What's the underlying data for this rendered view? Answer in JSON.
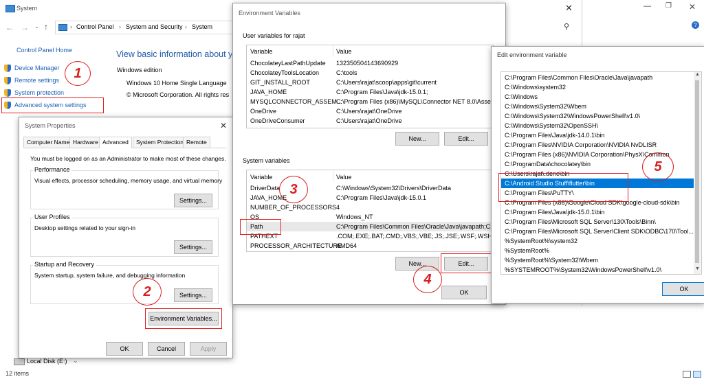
{
  "system_window": {
    "title": "System",
    "breadcrumb": [
      "Control Panel",
      "System and Security",
      "System"
    ],
    "left_links": {
      "home": "Control Panel Home",
      "items": [
        "Device Manager",
        "Remote settings",
        "System protection",
        "Advanced system settings"
      ]
    },
    "heading": "View basic information about yo",
    "edition_label": "Windows edition",
    "edition": "Windows 10 Home Single Language",
    "copyright": "© Microsoft Corporation. All rights res",
    "local_disk": "Local Disk (E:)",
    "items_count": "12 items"
  },
  "system_properties": {
    "title": "System Properties",
    "tabs": [
      "Computer Name",
      "Hardware",
      "Advanced",
      "System Protection",
      "Remote"
    ],
    "admin_note": "You must be logged on as an Administrator to make most of these changes.",
    "performance": {
      "label": "Performance",
      "desc": "Visual effects, processor scheduling, memory usage, and virtual memory",
      "button": "Settings..."
    },
    "user_profiles": {
      "label": "User Profiles",
      "desc": "Desktop settings related to your sign-in",
      "button": "Settings..."
    },
    "startup": {
      "label": "Startup and Recovery",
      "desc": "System startup, system failure, and debugging information",
      "button": "Settings..."
    },
    "env_button": "Environment Variables...",
    "ok": "OK",
    "cancel": "Cancel",
    "apply": "Apply"
  },
  "env_vars": {
    "title": "Environment Variables",
    "user_section": "User variables for rajat",
    "columns": [
      "Variable",
      "Value"
    ],
    "user_rows": [
      [
        "ChocolateyLastPathUpdate",
        "132350504143690929"
      ],
      [
        "ChocolateyToolsLocation",
        "C:\\tools"
      ],
      [
        "GIT_INSTALL_ROOT",
        "C:\\Users\\rajat\\scoop\\apps\\git\\current"
      ],
      [
        "JAVA_HOME",
        "C:\\Program Files\\Java\\jdk-15.0.1;"
      ],
      [
        "MYSQLCONNECTOR_ASSEM...",
        "C:\\Program Files (x86)\\MySQL\\Connector NET 8.0\\Assem"
      ],
      [
        "OneDrive",
        "C:\\Users\\rajat\\OneDrive"
      ],
      [
        "OneDriveConsumer",
        "C:\\Users\\rajat\\OneDrive"
      ]
    ],
    "user_new": "New...",
    "user_edit": "Edit...",
    "system_section": "System variables",
    "system_rows": [
      [
        "DriverData",
        "C:\\Windows\\System32\\Drivers\\DriverData"
      ],
      [
        "JAVA_HOME",
        "C:\\Program Files\\Java\\jdk-15.0.1"
      ],
      [
        "NUMBER_OF_PROCESSORS",
        "4"
      ],
      [
        "OS",
        "Windows_NT"
      ],
      [
        "Path",
        "C:\\Program Files\\Common Files\\Oracle\\Java\\javapath;C:"
      ],
      [
        "PATHEXT",
        ".COM;.EXE;.BAT;.CMD;.VBS;.VBE;.JS;.JSE;.WSF;.WSH;.MSC"
      ],
      [
        "PROCESSOR_ARCHITECTURE",
        "AMD64"
      ]
    ],
    "sys_new": "New...",
    "sys_edit": "Edit...",
    "ok": "OK"
  },
  "edit_env": {
    "title": "Edit environment variable",
    "entries": [
      "C:\\Program Files\\Common Files\\Oracle\\Java\\javapath",
      "C:\\Windows\\system32",
      "C:\\Windows",
      "C:\\Windows\\System32\\Wbem",
      "C:\\Windows\\System32\\WindowsPowerShell\\v1.0\\",
      "C:\\Windows\\System32\\OpenSSH\\",
      "C:\\Program Files\\Java\\jdk-14.0.1\\bin",
      "C:\\Program Files\\NVIDIA Corporation\\NVIDIA NvDLISR",
      "C:\\Program Files (x86)\\NVIDIA Corporation\\PhysX\\Common",
      "C:\\ProgramData\\chocolatey\\bin",
      "C:\\Users\\rajat\\.deno\\bin",
      "C:\\Android Studio Stuff\\flutter\\bin",
      "C:\\Program Files\\PuTTY\\",
      "C:\\Program Files (x86)\\Google\\Cloud SDK\\google-cloud-sdk\\bin",
      "C:\\Program Files\\Java\\jdk-15.0.1\\bin",
      "C:\\Program Files\\Microsoft SQL Server\\130\\Tools\\Binn\\",
      "C:\\Program Files\\Microsoft SQL Server\\Client SDK\\ODBC\\170\\Tool...",
      "%SystemRoot%\\system32",
      "%SystemRoot%",
      "%SystemRoot%\\System32\\Wbem",
      "%SYSTEMROOT%\\System32\\WindowsPowerShell\\v1.0\\"
    ],
    "selected_index": 11,
    "ok": "OK"
  },
  "step_markers": [
    "1",
    "2",
    "3",
    "4",
    "5"
  ],
  "colors": {
    "selection": "#0078d7",
    "annotation": "#e02020",
    "link": "#1a5fb4"
  }
}
